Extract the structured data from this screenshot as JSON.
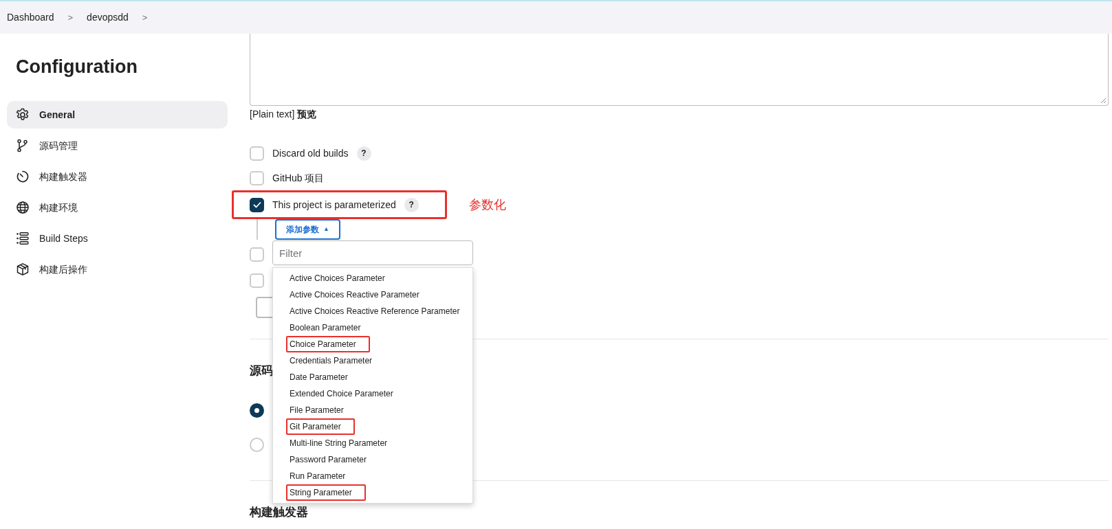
{
  "breadcrumb": [
    {
      "label": "Dashboard",
      "separator": ">"
    },
    {
      "label": "devopsdd",
      "separator": ">"
    }
  ],
  "sidebar": {
    "title": "Configuration",
    "items": [
      {
        "label": "General",
        "selected": true
      },
      {
        "label": "源码管理",
        "selected": false
      },
      {
        "label": "构建触发器",
        "selected": false
      },
      {
        "label": "构建环境",
        "selected": false
      },
      {
        "label": "Build Steps",
        "selected": false
      },
      {
        "label": "构建后操作",
        "selected": false
      }
    ]
  },
  "description": {
    "format_note": "[Plain text]",
    "preview_link": "预览"
  },
  "options": [
    {
      "label": "Discard old builds",
      "checked": false,
      "help": "?",
      "highlighted": false
    },
    {
      "label": "GitHub 项目",
      "checked": false,
      "highlighted": false
    },
    {
      "label": "This project is parameterized",
      "checked": true,
      "help": "?",
      "highlighted": true,
      "annotation": "参数化"
    }
  ],
  "add_parameter": {
    "label": "添加参数",
    "caret": "▲",
    "expanded": true,
    "filter": {
      "placeholder": "Filter"
    },
    "menu": [
      {
        "label": "Active Choices Parameter",
        "highlighted": false
      },
      {
        "label": "Active Choices Reactive Parameter",
        "highlighted": false
      },
      {
        "label": "Active Choices Reactive Reference Parameter",
        "highlighted": false
      },
      {
        "label": "Boolean Parameter",
        "highlighted": false
      },
      {
        "label": "Choice Parameter",
        "highlighted": true
      },
      {
        "label": "Credentials Parameter",
        "highlighted": false
      },
      {
        "label": "Date Parameter",
        "highlighted": false
      },
      {
        "label": "Extended Choice Parameter",
        "highlighted": false
      },
      {
        "label": "File Parameter",
        "highlighted": false
      },
      {
        "label": "Git Parameter",
        "highlighted": true
      },
      {
        "label": "Multi-line String Parameter",
        "highlighted": false
      },
      {
        "label": "Password Parameter",
        "highlighted": false
      },
      {
        "label": "Run Parameter",
        "highlighted": false
      },
      {
        "label": "String Parameter",
        "highlighted": true
      }
    ]
  },
  "covered_options": [
    {
      "checked": false
    },
    {
      "checked": false
    }
  ],
  "source_section": {
    "heading": "源码",
    "choices": [
      {
        "selected": true
      },
      {
        "selected": false
      }
    ]
  },
  "trigger_section": {
    "heading": "构建触发器"
  }
}
